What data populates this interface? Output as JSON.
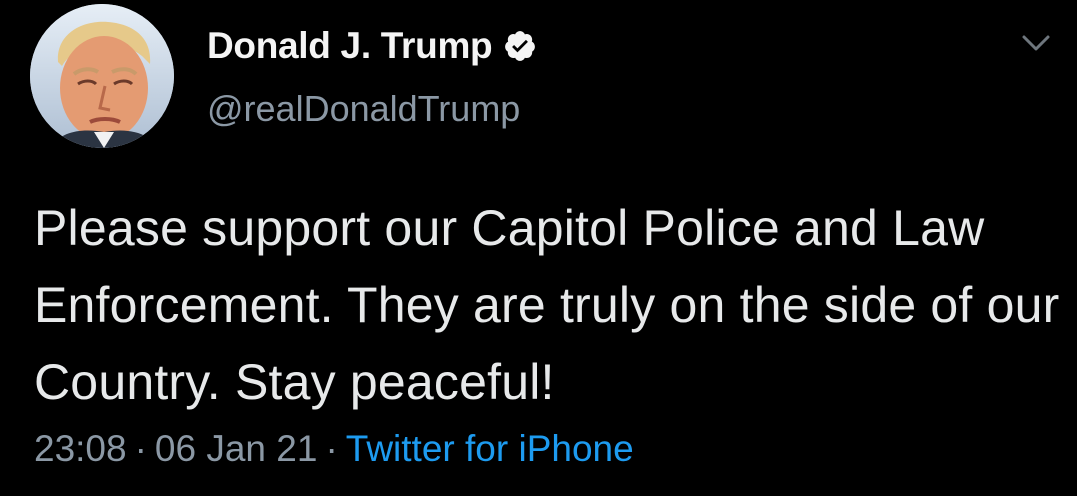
{
  "author": {
    "display_name": "Donald J. Trump",
    "handle": "@realDonaldTrump",
    "verified": true,
    "avatar": "profile-photo"
  },
  "tweet": {
    "text": "Please support our Capitol Police and Law Enforcement. They are truly on the side of our Country. Stay peaceful!",
    "time": "23:08",
    "date": "06 Jan 21",
    "source": "Twitter for iPhone"
  },
  "icons": {
    "verified": "verified-badge-icon",
    "more": "chevron-down-icon"
  },
  "colors": {
    "background": "#000000",
    "text": "#e7e9ea",
    "secondary": "#8b98a5",
    "link": "#1d9bf0"
  },
  "meta_separator": "·"
}
